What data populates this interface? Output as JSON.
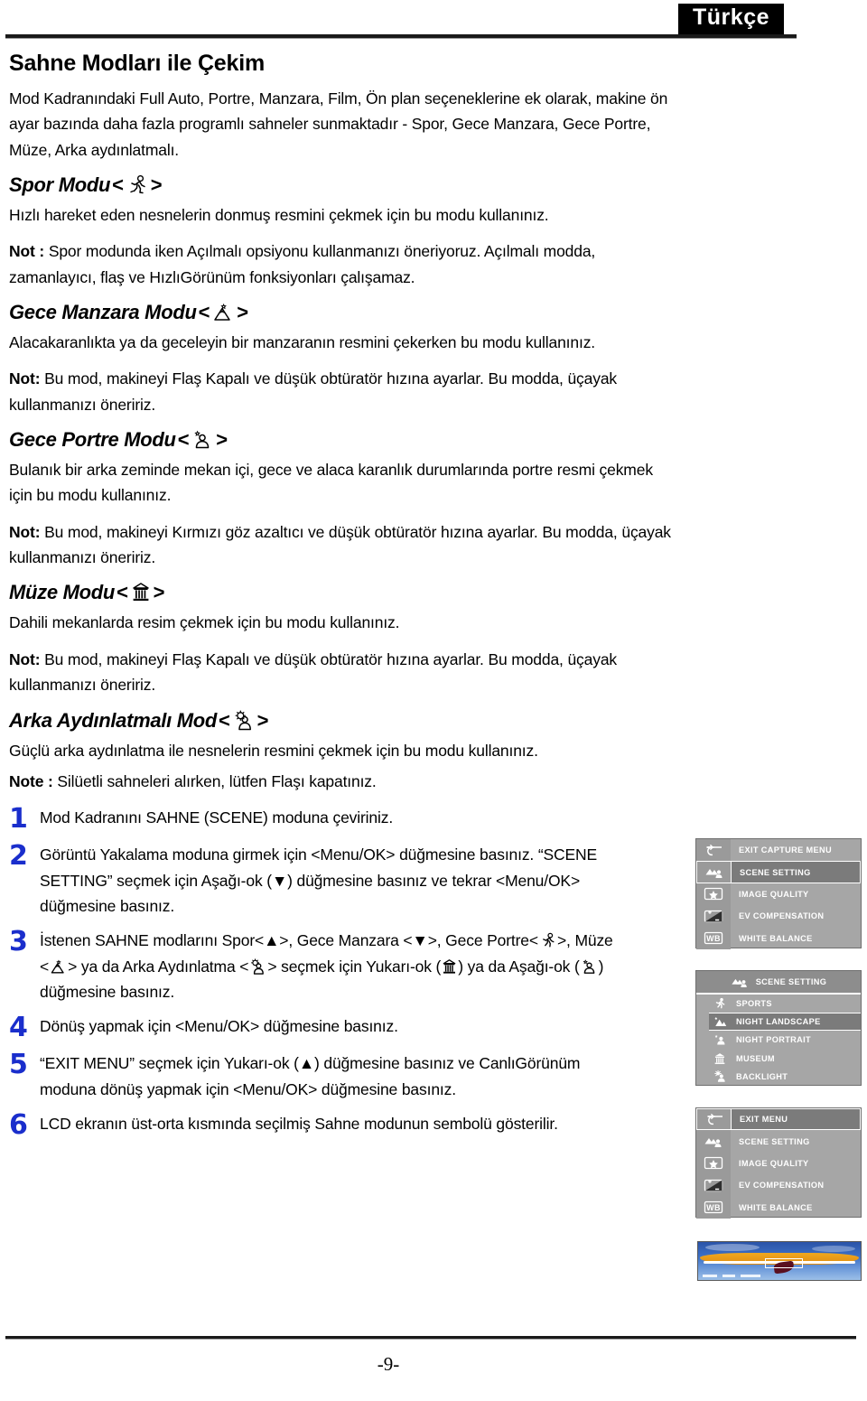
{
  "header": {
    "language_badge": "Türkçe"
  },
  "page": {
    "title": "Sahne Modları ile Çekim",
    "intro": "Mod Kadranındaki Full Auto, Portre, Manzara, Film, Ön plan seçeneklerine ek olarak, makine ön ayar bazında daha fazla programlı sahneler sunmaktadır - Spor, Gece Manzara, Gece Portre, Müze, Arka aydınlatmalı.",
    "page_number": "-9-"
  },
  "modes": [
    {
      "id": "sports",
      "title": "Spor Modu",
      "icon": "running-person-icon",
      "bracket_open": "<",
      "bracket_close": ">",
      "description": "Hızlı hareket eden nesnelerin donmuş resmini çekmek için bu modu kullanınız.",
      "note_label": "Not : ",
      "note": "Spor modunda iken Açılmalı opsiyonu kullanmanızı öneriyoruz. Açılmalı modda, zamanlayıcı, flaş ve HızlıGörünüm fonksiyonları çalışamaz."
    },
    {
      "id": "night-landscape",
      "title": "Gece Manzara Modu",
      "icon": "mountain-star-icon",
      "bracket_open": "<",
      "bracket_close": ">",
      "description": "Alacakaranlıkta ya da geceleyin bir manzaranın resmini çekerken bu modu kullanınız.",
      "note_label": "Not: ",
      "note": "Bu mod, makineyi Flaş Kapalı ve düşük obtüratör hızına ayarlar. Bu modda, üçayak kullanmanızı öneririz."
    },
    {
      "id": "night-portrait",
      "title": "Gece Portre Modu",
      "icon": "person-star-icon",
      "bracket_open": "<",
      "bracket_close": ">",
      "description": "Bulanık bir arka zeminde mekan içi, gece ve alaca karanlık durumlarında portre resmi çekmek için bu modu kullanınız.",
      "note_label": "Not: ",
      "note": "Bu mod, makineyi Kırmızı göz azaltıcı ve düşük obtüratör hızına ayarlar. Bu modda, üçayak kullanmanızı öneririz."
    },
    {
      "id": "museum",
      "title": "Müze Modu",
      "icon": "museum-building-icon",
      "bracket_open": "<",
      "bracket_close": ">",
      "description": "Dahili mekanlarda resim çekmek için bu modu kullanınız.",
      "note_label": "Not: ",
      "note": "Bu mod, makineyi Flaş Kapalı ve düşük obtüratör hızına ayarlar. Bu modda, üçayak kullanmanızı öneririz."
    },
    {
      "id": "backlight",
      "title": "Arka Aydınlatmalı Mod",
      "icon": "backlight-person-icon",
      "bracket_open": "<",
      "bracket_close": ">",
      "description": "Güçlü arka aydınlatma ile nesnelerin resmini çekmek için bu modu kullanınız.",
      "note_label": "Note : ",
      "note": "Silüetli sahneleri alırken, lütfen Flaşı kapatınız."
    }
  ],
  "steps": [
    {
      "number": "1",
      "text": "Mod Kadranını SAHNE (SCENE) moduna çeviriniz."
    },
    {
      "number": "2",
      "text_part1": "Görüntü Yakalama moduna girmek için <Menu/OK> düğmesine basınız. “SCENE SETTING” seçmek için Aşağı-ok (",
      "down_arrow": "▼",
      "text_part2": ") düğmesine basınız ve tekrar <Menu/OK> düğmesine basınız."
    },
    {
      "number": "3",
      "t1": "İstenen SAHNE modlarını Spor<",
      "up_arrow": "▲",
      "t2": ">, Gece Manzara <",
      "down_arrow": "▼",
      "t3": ">, Gece Portre<",
      "t4": ">, Müze <",
      "t5": "> ya da Arka Aydınlatma <",
      "t6": "> seçmek için Yukarı-ok (",
      "t7": ") ya da Aşağı-ok (",
      "t8": ") düğmesine basınız."
    },
    {
      "number": "4",
      "text": "Dönüş yapmak için <Menu/OK> düğmesine basınız."
    },
    {
      "number": "5",
      "text_part1": "“EXIT MENU” seçmek için Yukarı-ok (",
      "up_arrow": "▲",
      "text_part2": ") düğmesine basınız ve CanlıGörünüm moduna dönüş yapmak için <Menu/OK> düğmesine basınız."
    },
    {
      "number": "6",
      "text": "LCD ekranın üst-orta kısmında seçilmiş Sahne modunun sembolü gösterilir."
    }
  ],
  "lcd_panels": [
    {
      "id": "capture-menu",
      "rows": [
        {
          "label": "EXIT CAPTURE MENU",
          "icon": "back-arrow-icon",
          "selected": false
        },
        {
          "label": "SCENE SETTING",
          "icon": "scene-setting-icon",
          "selected": true
        },
        {
          "label": "IMAGE QUALITY",
          "icon": "star-box-icon",
          "selected": false
        },
        {
          "label": "EV COMPENSATION",
          "icon": "ev-compensation-icon",
          "selected": false
        },
        {
          "label": "WHITE BALANCE",
          "icon": "wb-icon",
          "selected": false
        }
      ]
    },
    {
      "id": "scene-setting-submenu",
      "header": {
        "label": "SCENE SETTING",
        "icon": "scene-setting-icon"
      },
      "rows": [
        {
          "label": "SPORTS",
          "icon": "running-person-icon",
          "selected": false
        },
        {
          "label": "NIGHT LANDSCAPE",
          "icon": "mountain-star-icon",
          "selected": true
        },
        {
          "label": "NIGHT PORTRAIT",
          "icon": "person-star-icon",
          "selected": false
        },
        {
          "label": "MUSEUM",
          "icon": "museum-building-icon",
          "selected": false
        },
        {
          "label": "BACKLIGHT",
          "icon": "backlight-person-icon",
          "selected": false
        }
      ]
    },
    {
      "id": "exit-menu",
      "rows": [
        {
          "label": "EXIT MENU",
          "icon": "back-arrow-icon",
          "selected": true
        },
        {
          "label": "SCENE SETTING",
          "icon": "scene-setting-icon",
          "selected": false
        },
        {
          "label": "IMAGE QUALITY",
          "icon": "star-box-icon",
          "selected": false
        },
        {
          "label": "EV COMPENSATION",
          "icon": "ev-compensation-icon",
          "selected": false
        },
        {
          "label": "WHITE BALANCE",
          "icon": "wb-icon",
          "selected": false
        }
      ]
    }
  ],
  "sample_photo": {
    "caption": "hang-glider-sample-photo"
  },
  "colors": {
    "step_number": "#1a2ecc",
    "lcd_background": "#a6a6a6",
    "lcd_selected": "#7b7b7b",
    "badge_background": "#000000"
  }
}
